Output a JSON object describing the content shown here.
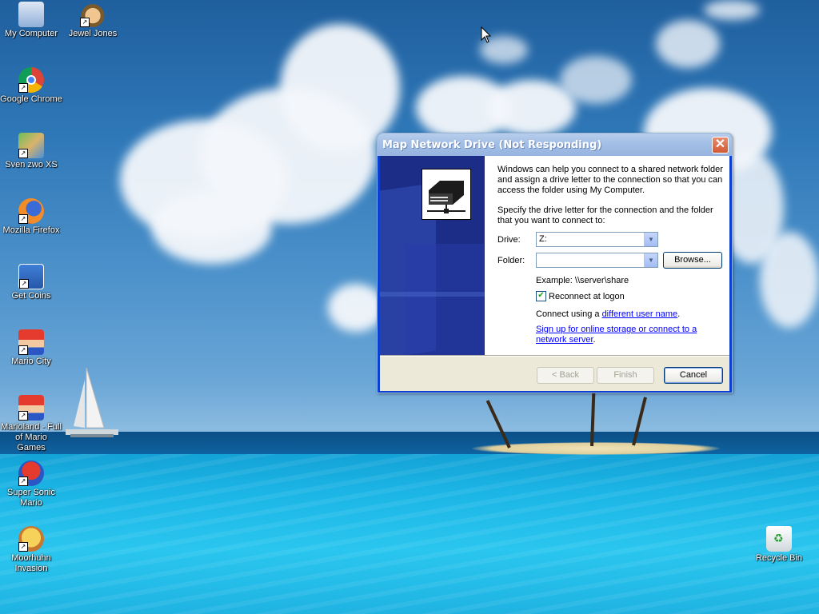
{
  "desktop": {
    "icons_left": [
      {
        "label": "My Computer",
        "icon": "my-computer-icon",
        "shortcut": false
      },
      {
        "label": "Google Chrome",
        "icon": "chrome-icon",
        "shortcut": true
      },
      {
        "label": "Sven zwo XS",
        "icon": "game-icon",
        "shortcut": true
      },
      {
        "label": "Mozilla Firefox",
        "icon": "firefox-icon",
        "shortcut": true
      },
      {
        "label": "Get Coins",
        "icon": "game-icon",
        "shortcut": true
      },
      {
        "label": "Mario City",
        "icon": "mario-icon",
        "shortcut": true
      },
      {
        "label": "Marioland - Full of Mario Games",
        "icon": "mario-icon",
        "shortcut": true
      },
      {
        "label": "Super Sonic Mario",
        "icon": "sonic-icon",
        "shortcut": true
      },
      {
        "label": "Moorhuhn Invasion",
        "icon": "chicken-icon",
        "shortcut": true
      }
    ],
    "icon_jewel": {
      "label": "Jewel Jones",
      "icon": "jewel-jones-icon"
    },
    "recycle_bin": {
      "label": "Recycle Bin",
      "icon": "recycle-bin-icon"
    }
  },
  "dialog": {
    "title": "Map Network Drive (Not Responding)",
    "intro": "Windows can help you connect to a shared network folder and assign a drive letter to the connection so that you can access the folder using My Computer.",
    "instructions": "Specify the drive letter for the connection and the folder that you want to connect to:",
    "drive_label": "Drive:",
    "drive_value": "Z:",
    "folder_label": "Folder:",
    "folder_value": "",
    "browse_label": "Browse...",
    "example": "Example: \\\\server\\share",
    "reconnect_label": "Reconnect at logon",
    "reconnect_checked": true,
    "connect_prefix": "Connect using a ",
    "connect_link": "different user name",
    "connect_suffix": ".",
    "signup_link": "Sign up for online storage or connect to a network server",
    "signup_suffix": ".",
    "back_label": "< Back",
    "finish_label": "Finish",
    "cancel_label": "Cancel"
  },
  "colors": {
    "accent": "#0a3fd0",
    "side_panel": "#1b2d86",
    "link": "#0000ff"
  }
}
